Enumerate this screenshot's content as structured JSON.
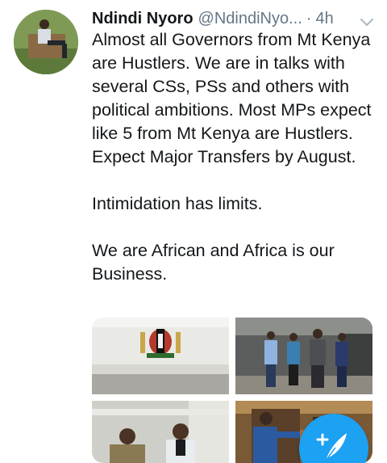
{
  "tweet": {
    "author_name": "Ndindi Nyoro",
    "author_handle": "@NdindiNyo...",
    "separator": "·",
    "time": "4h",
    "paragraphs": [
      "Almost all Governors from Mt Kenya are Hustlers. We are in talks with several CSs, PSs and others with political ambitions. Most MPs expect like 5 from Mt Kenya are Hustlers. Expect Major Transfers by August.",
      "Intimidation has limits.",
      "We are African and Africa is our Business."
    ]
  },
  "icons": {
    "menu": "chevron-down-icon",
    "compose": "compose-tweet-icon"
  },
  "colors": {
    "accent": "#1da1f2",
    "secondary_text": "#657786",
    "primary_text": "#14171a"
  }
}
